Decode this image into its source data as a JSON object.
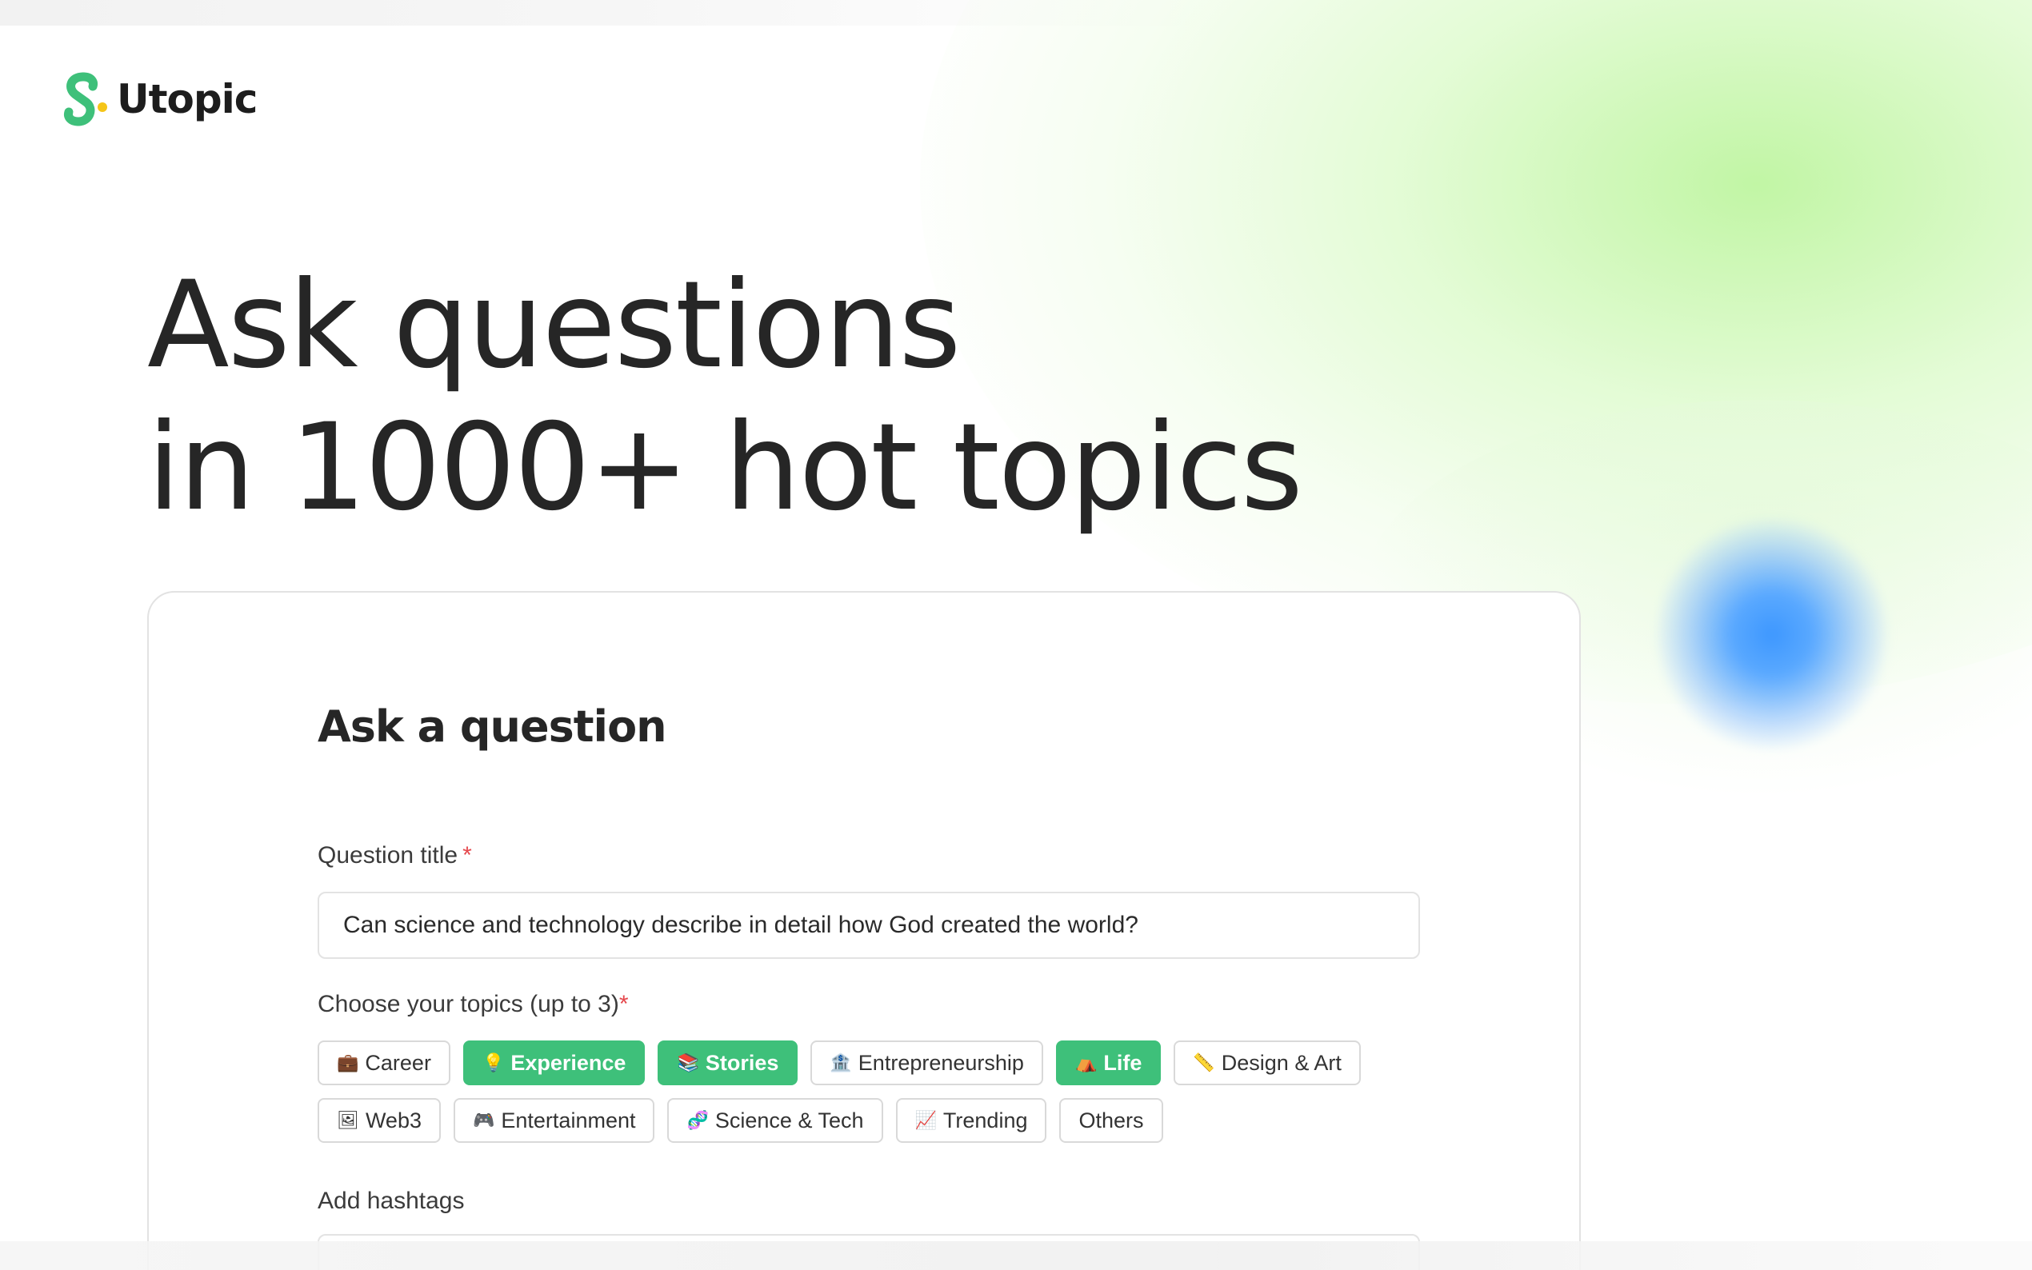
{
  "brand": {
    "name": "Utopic",
    "colors": {
      "primary": "#3ec07a",
      "accent_dot": "#f5c518",
      "orb": "#3d97ff",
      "glow": "#c8f5b0"
    }
  },
  "hero": {
    "line1": "Ask questions",
    "line2": "in 1000+ hot topics"
  },
  "form": {
    "heading": "Ask a question",
    "title_field": {
      "label": "Question title",
      "required_mark": "*",
      "value": "Can science and technology describe in detail how God created the world?"
    },
    "topics_field": {
      "label": "Choose your topics (up to 3)",
      "required_mark": "*",
      "rows": [
        [
          {
            "icon": "💼",
            "icon_name": "briefcase-icon",
            "label": "Career",
            "selected": false
          },
          {
            "icon": "💡",
            "icon_name": "lightbulb-icon",
            "label": "Experience",
            "selected": true
          },
          {
            "icon": "📚",
            "icon_name": "books-icon",
            "label": "Stories",
            "selected": true
          },
          {
            "icon": "🏦",
            "icon_name": "bank-icon",
            "label": "Entrepreneurship",
            "selected": false
          },
          {
            "icon": "⛺",
            "icon_name": "tent-icon",
            "label": "Life",
            "selected": true
          },
          {
            "icon": "📏",
            "icon_name": "ruler-icon",
            "label": "Design & Art",
            "selected": false
          }
        ],
        [
          {
            "icon": "🖼",
            "icon_name": "picture-icon",
            "label": "Web3",
            "selected": false
          },
          {
            "icon": "🎮",
            "icon_name": "gamepad-icon",
            "label": "Entertainment",
            "selected": false
          },
          {
            "icon": "🧬",
            "icon_name": "dna-icon",
            "label": "Science & Tech",
            "selected": false
          },
          {
            "icon": "📈",
            "icon_name": "chart-up-icon",
            "label": "Trending",
            "selected": false
          },
          {
            "icon": "",
            "icon_name": "",
            "label": "Others",
            "selected": false
          }
        ]
      ]
    },
    "hashtags_field": {
      "label": "Add hashtags"
    }
  }
}
